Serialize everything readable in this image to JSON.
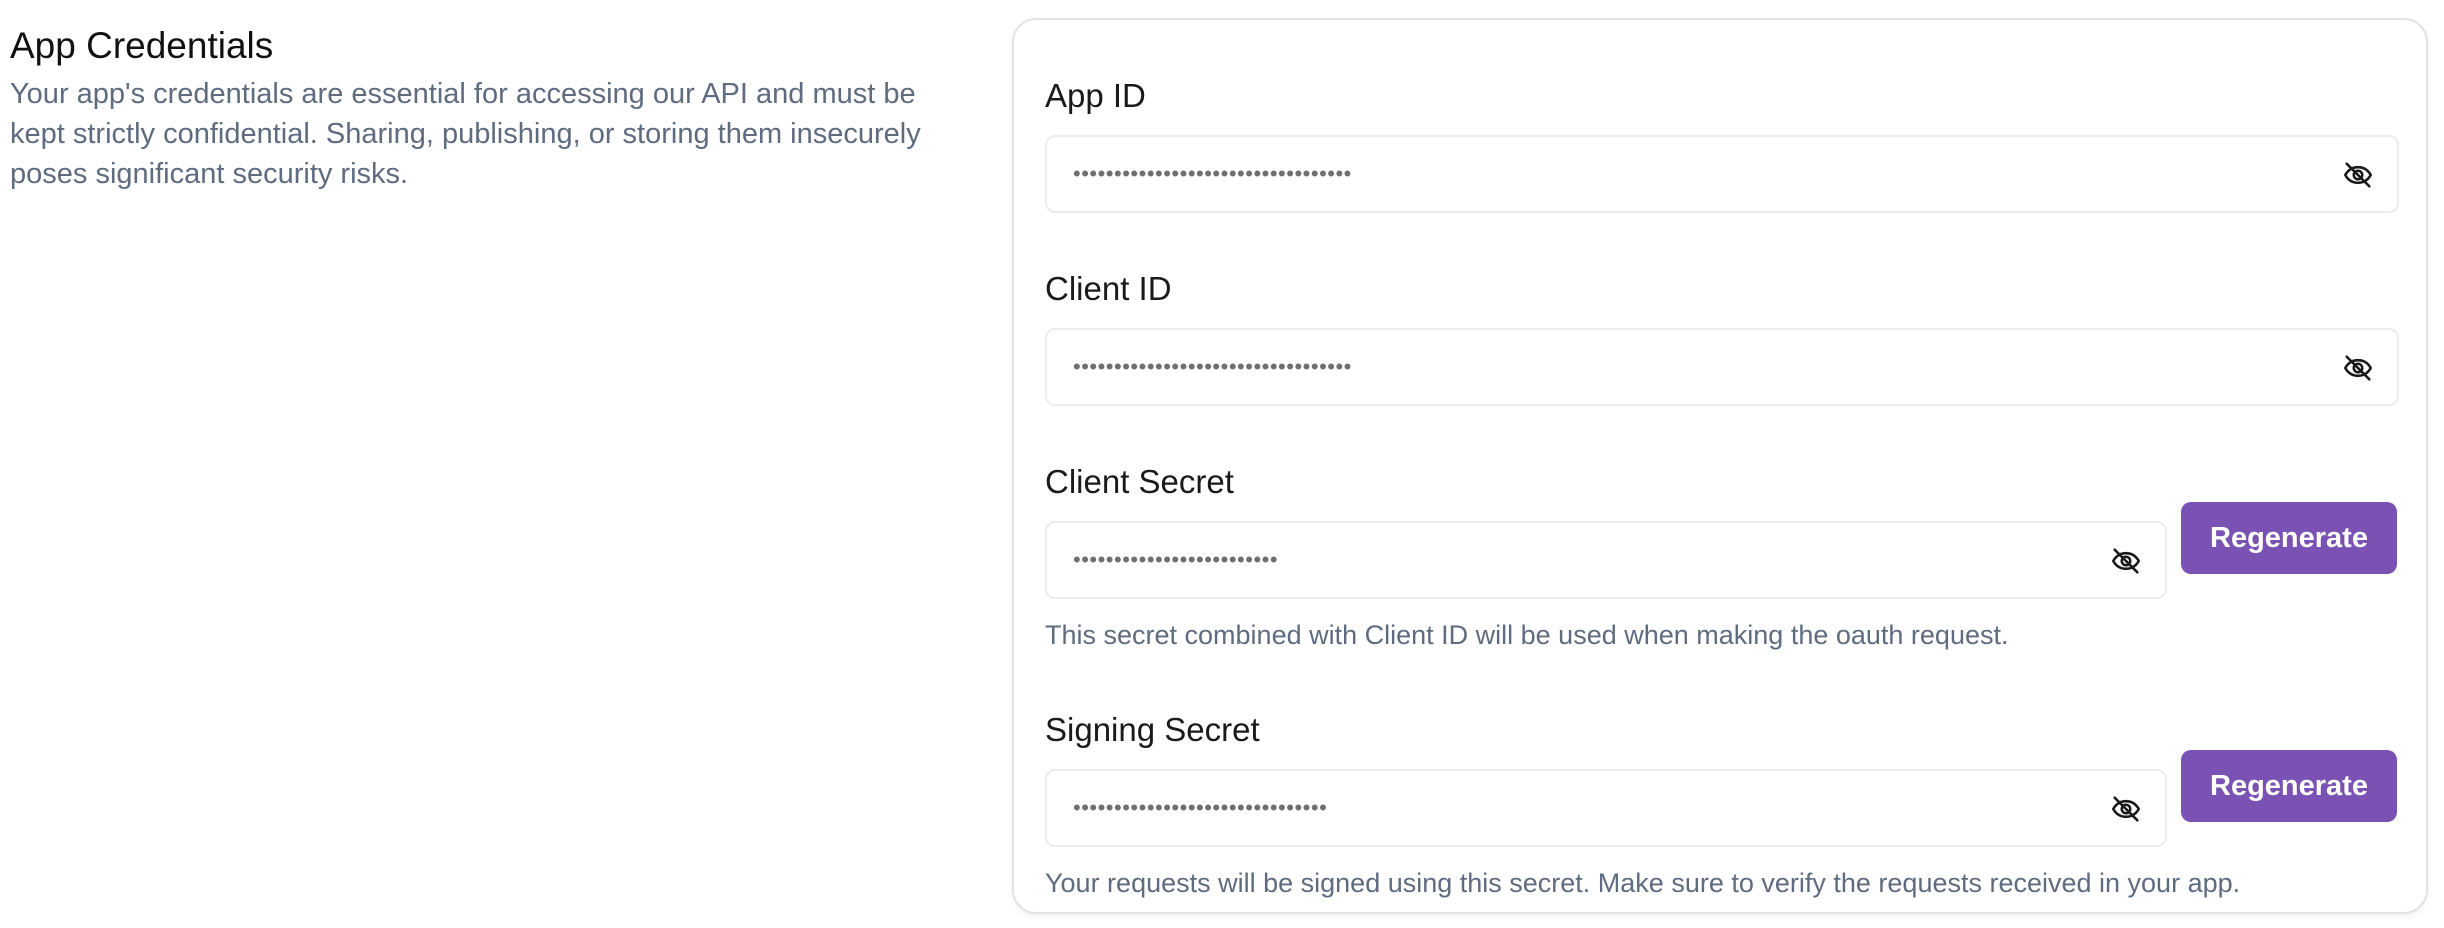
{
  "section": {
    "title": "App Credentials",
    "description": "Your app's credentials are essential for accessing our API and must be kept strictly confidential. Sharing, publishing, or storing them insecurely poses significant security risks."
  },
  "fields": {
    "app_id": {
      "label": "App ID",
      "masked_value": "••••••••••••••••••••••••••••••••••",
      "icon": "eye-off-icon"
    },
    "client_id": {
      "label": "Client ID",
      "masked_value": "••••••••••••••••••••••••••••••••••",
      "icon": "eye-off-icon"
    },
    "client_secret": {
      "label": "Client Secret",
      "masked_value": "•••••••••••••••••••••••••",
      "icon": "eye-off-icon",
      "button_label": "Regenerate",
      "hint": "This secret combined with Client ID will be used when making the oauth request."
    },
    "signing_secret": {
      "label": "Signing Secret",
      "masked_value": "•••••••••••••••••••••••••••••••",
      "icon": "eye-off-icon",
      "button_label": "Regenerate",
      "hint": "Your requests will be signed using this secret. Make sure to verify the requests received in your app."
    }
  },
  "colors": {
    "accent": "#7952b3",
    "muted_text": "#5f6b7f",
    "border": "#ececef"
  }
}
